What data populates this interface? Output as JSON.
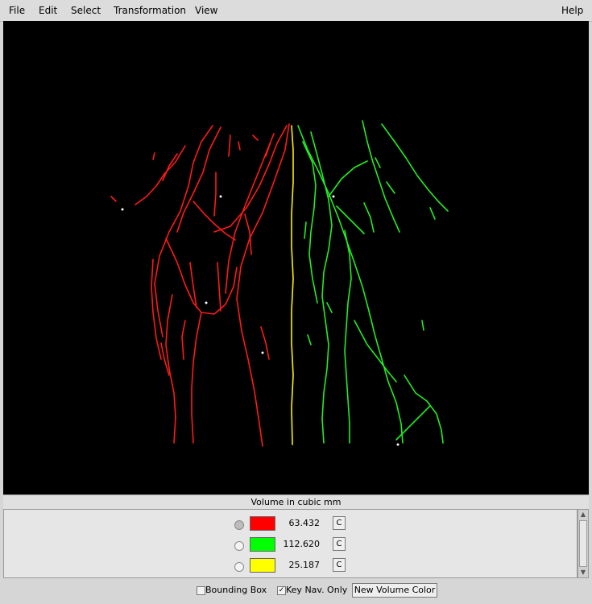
{
  "menubar": {
    "file": "File",
    "edit": "Edit",
    "select": "Select",
    "transformation": "Transformation",
    "view": "View",
    "help": "Help"
  },
  "panel": {
    "title": "Volume in cubic mm",
    "rows": [
      {
        "color": "#ff0000",
        "volume": "63.432",
        "button": "C",
        "selected": true
      },
      {
        "color": "#00ff00",
        "volume": "112.620",
        "button": "C",
        "selected": false
      },
      {
        "color": "#ffff00",
        "volume": "25.187",
        "button": "C",
        "selected": false
      }
    ]
  },
  "controls": {
    "bounding_box_label": "Bounding Box",
    "bounding_box_checked": false,
    "key_nav_label": "Key Nav. Only",
    "key_nav_checked": true,
    "new_volume_color_label": "New Volume Color"
  }
}
